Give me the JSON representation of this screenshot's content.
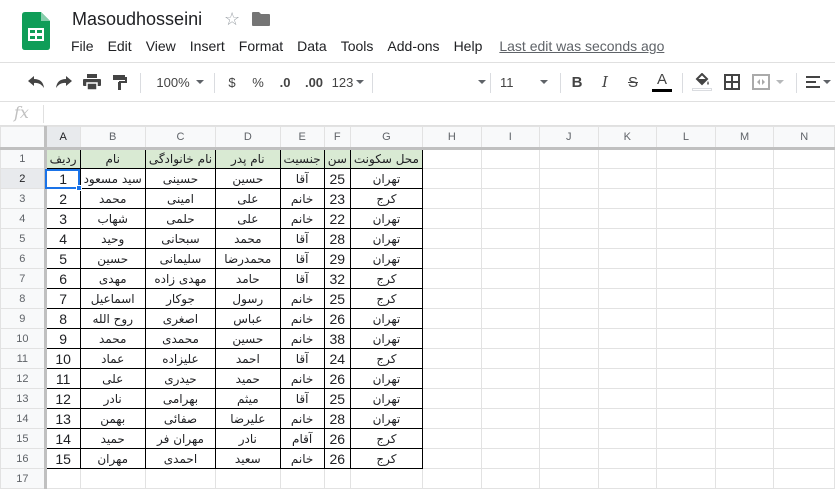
{
  "app": {
    "title": "Masoudhosseini",
    "last_edit": "Last edit was seconds ago",
    "brand_color": "#0f9d58",
    "menu": [
      "File",
      "Edit",
      "View",
      "Insert",
      "Format",
      "Data",
      "Tools",
      "Add-ons",
      "Help"
    ]
  },
  "toolbar": {
    "zoom": "100%",
    "currency": "$",
    "percent": "%",
    "decrease_decimal": ".0",
    "increase_decimal": ".00",
    "more_formats": "123",
    "font_size": "11",
    "bold": "B",
    "italic": "I",
    "strike": "S",
    "text_color_letter": "A",
    "text_color": "#000000",
    "fill_color": "#ffffff"
  },
  "formula_bar": {
    "fx": "fx",
    "value": ""
  },
  "sheet": {
    "columns": [
      "A",
      "B",
      "C",
      "D",
      "E",
      "F",
      "G",
      "H",
      "I",
      "J",
      "K",
      "L",
      "M",
      "N"
    ],
    "row_numbers": [
      "1",
      "2",
      "3",
      "4",
      "5",
      "6",
      "7",
      "8",
      "9",
      "10",
      "11",
      "12",
      "13",
      "14",
      "15",
      "16",
      "17"
    ],
    "header_fill": "#d9ead3",
    "selection_color": "#1a73e8",
    "headers": [
      "ردیف",
      "نام",
      "نام خانوادگی",
      "نام پدر",
      "جنسیت",
      "سن",
      "محل سکونت"
    ],
    "rows": [
      [
        "1",
        "سید مسعود",
        "حسینی",
        "حسین",
        "آقا",
        "25",
        "تهران"
      ],
      [
        "2",
        "محمد",
        "امینی",
        "علی",
        "خانم",
        "23",
        "کرج"
      ],
      [
        "3",
        "شهاب",
        "حلمی",
        "علی",
        "خانم",
        "22",
        "تهران"
      ],
      [
        "4",
        "وحید",
        "سبحانی",
        "محمد",
        "آقا",
        "28",
        "تهران"
      ],
      [
        "5",
        "حسین",
        "سلیمانی",
        "محمدرضا",
        "آقا",
        "29",
        "تهران"
      ],
      [
        "6",
        "مهدی",
        "مهدی زاده",
        "حامد",
        "آقا",
        "32",
        "کرج"
      ],
      [
        "7",
        "اسماعیل",
        "جوکار",
        "رسول",
        "خانم",
        "25",
        "کرج"
      ],
      [
        "8",
        "روح الله",
        "اصغری",
        "عباس",
        "خانم",
        "26",
        "تهران"
      ],
      [
        "9",
        "محمد",
        "محمدی",
        "حسین",
        "خانم",
        "38",
        "تهران"
      ],
      [
        "10",
        "عماد",
        "علیزاده",
        "احمد",
        "آقا",
        "24",
        "کرج"
      ],
      [
        "11",
        "علی",
        "حیدری",
        "حمید",
        "خانم",
        "26",
        "تهران"
      ],
      [
        "12",
        "نادر",
        "بهرامی",
        "میثم",
        "آقا",
        "25",
        "تهران"
      ],
      [
        "13",
        "بهمن",
        "صفائی",
        "علیرضا",
        "خانم",
        "28",
        "تهران"
      ],
      [
        "14",
        "حمید",
        "مهران فر",
        "نادر",
        "آقام",
        "26",
        "کرج"
      ],
      [
        "15",
        "مهران",
        "احمدی",
        "سعید",
        "خانم",
        "26",
        "کرج"
      ]
    ]
  }
}
